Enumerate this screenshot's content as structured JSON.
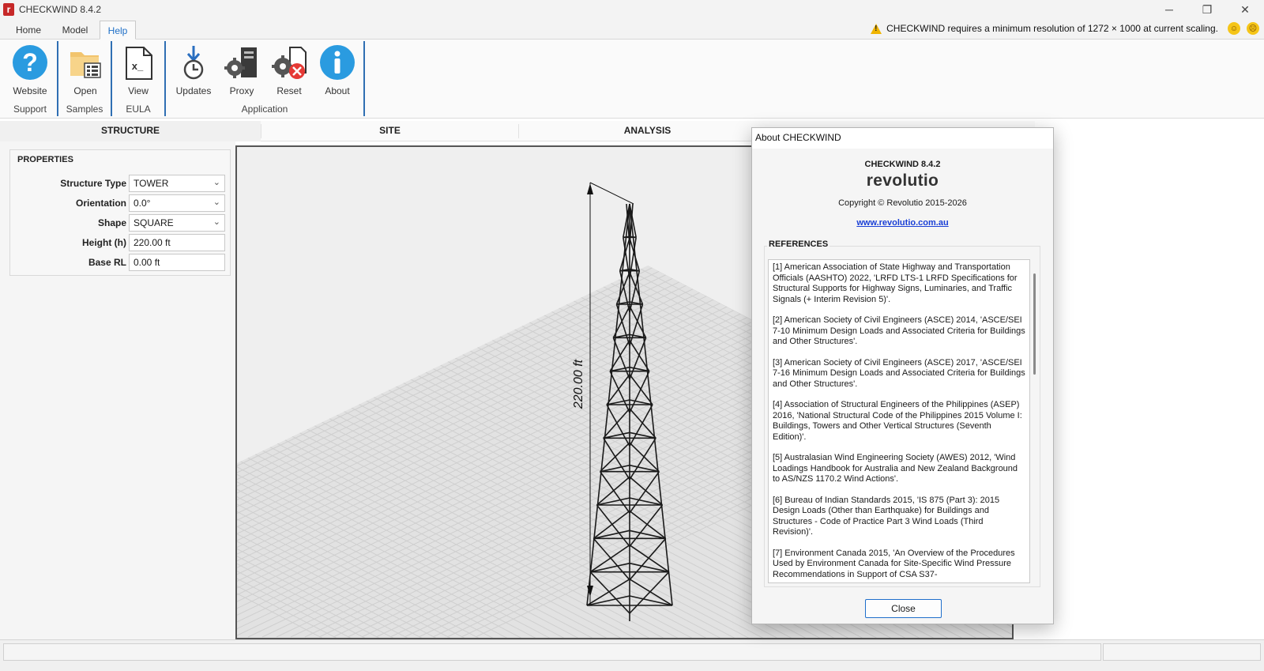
{
  "app": {
    "title": "CHECKWIND 8.4.2",
    "logo_letter": "r"
  },
  "window_controls": {
    "minimize": "─",
    "maximize": "❐",
    "close": "✕"
  },
  "menu": {
    "tabs": [
      "Home",
      "Model",
      "Help"
    ],
    "active_tab": "Help",
    "warning": "CHECKWIND requires a minimum resolution of 1272 × 1000 at current scaling.",
    "face_happy": "☺",
    "face_sad": "☹"
  },
  "ribbon": {
    "buttons": {
      "website": "Website",
      "open": "Open",
      "view": "View",
      "updates": "Updates",
      "proxy": "Proxy",
      "reset": "Reset",
      "about": "About"
    },
    "groups": {
      "support": "Support",
      "samples": "Samples",
      "eula": "EULA",
      "application": "Application"
    }
  },
  "view_tabs": [
    "STRUCTURE",
    "SITE",
    "ANALYSIS"
  ],
  "properties": {
    "title": "PROPERTIES",
    "rows": [
      {
        "label": "Structure Type",
        "value": "TOWER",
        "dropdown": true
      },
      {
        "label": "Orientation",
        "value": "0.0°",
        "dropdown": true
      },
      {
        "label": "Shape",
        "value": "SQUARE",
        "dropdown": true
      },
      {
        "label": "Height (h)",
        "value": "220.00 ft",
        "dropdown": false
      },
      {
        "label": "Base RL",
        "value": "0.00 ft",
        "dropdown": false
      }
    ]
  },
  "viewport": {
    "dimension_label": "220.00 ft"
  },
  "about_dialog": {
    "title": "About CHECKWIND",
    "version": "CHECKWIND 8.4.2",
    "brand": "revolutio",
    "copyright": "Copyright © Revolutio 2015-2026",
    "website": "www.revolutio.com.au",
    "references_title": "REFERENCES",
    "references": [
      "[1] American Association of State Highway and Transportation Officials (AASHTO) 2022, 'LRFD LTS-1 LRFD Specifications for Structural Supports for Highway Signs, Luminaries, and Traffic Signals (+ Interim Revision 5)'.",
      "[2] American Society of Civil Engineers (ASCE) 2014, 'ASCE/SEI 7-10 Minimum Design Loads and Associated Criteria for Buildings and Other Structures'.",
      "[3] American Society of Civil Engineers (ASCE) 2017, 'ASCE/SEI 7-16 Minimum Design Loads and Associated Criteria for Buildings and Other Structures'.",
      "[4] Association of Structural Engineers of the Philippines (ASEP) 2016, 'National Structural Code of the Philippines 2015 Volume I: Buildings, Towers and Other Vertical Structures (Seventh Edition)'.",
      "[5] Australasian Wind Engineering Society (AWES) 2012, 'Wind Loadings Handbook for Australia and New Zealand Background to AS/NZS 1170.2 Wind Actions'.",
      "[6] Bureau of Indian Standards 2015, 'IS 875 (Part 3): 2015 Design Loads (Other than Earthquake) for Buildings and Structures - Code of Practice Part 3 Wind Loads (Third Revision)'.",
      "[7] Environment Canada 2015, 'An Overview of the Procedures Used by Environment Canada for Site-Specific Wind Pressure Recommendations in Support of CSA S37-"
    ],
    "close_label": "Close"
  },
  "colors": {
    "accent": "#1e6fc7",
    "ribbon_separator": "#2f6fb3",
    "warning": "#f0b400",
    "reset_red": "#e53935"
  }
}
